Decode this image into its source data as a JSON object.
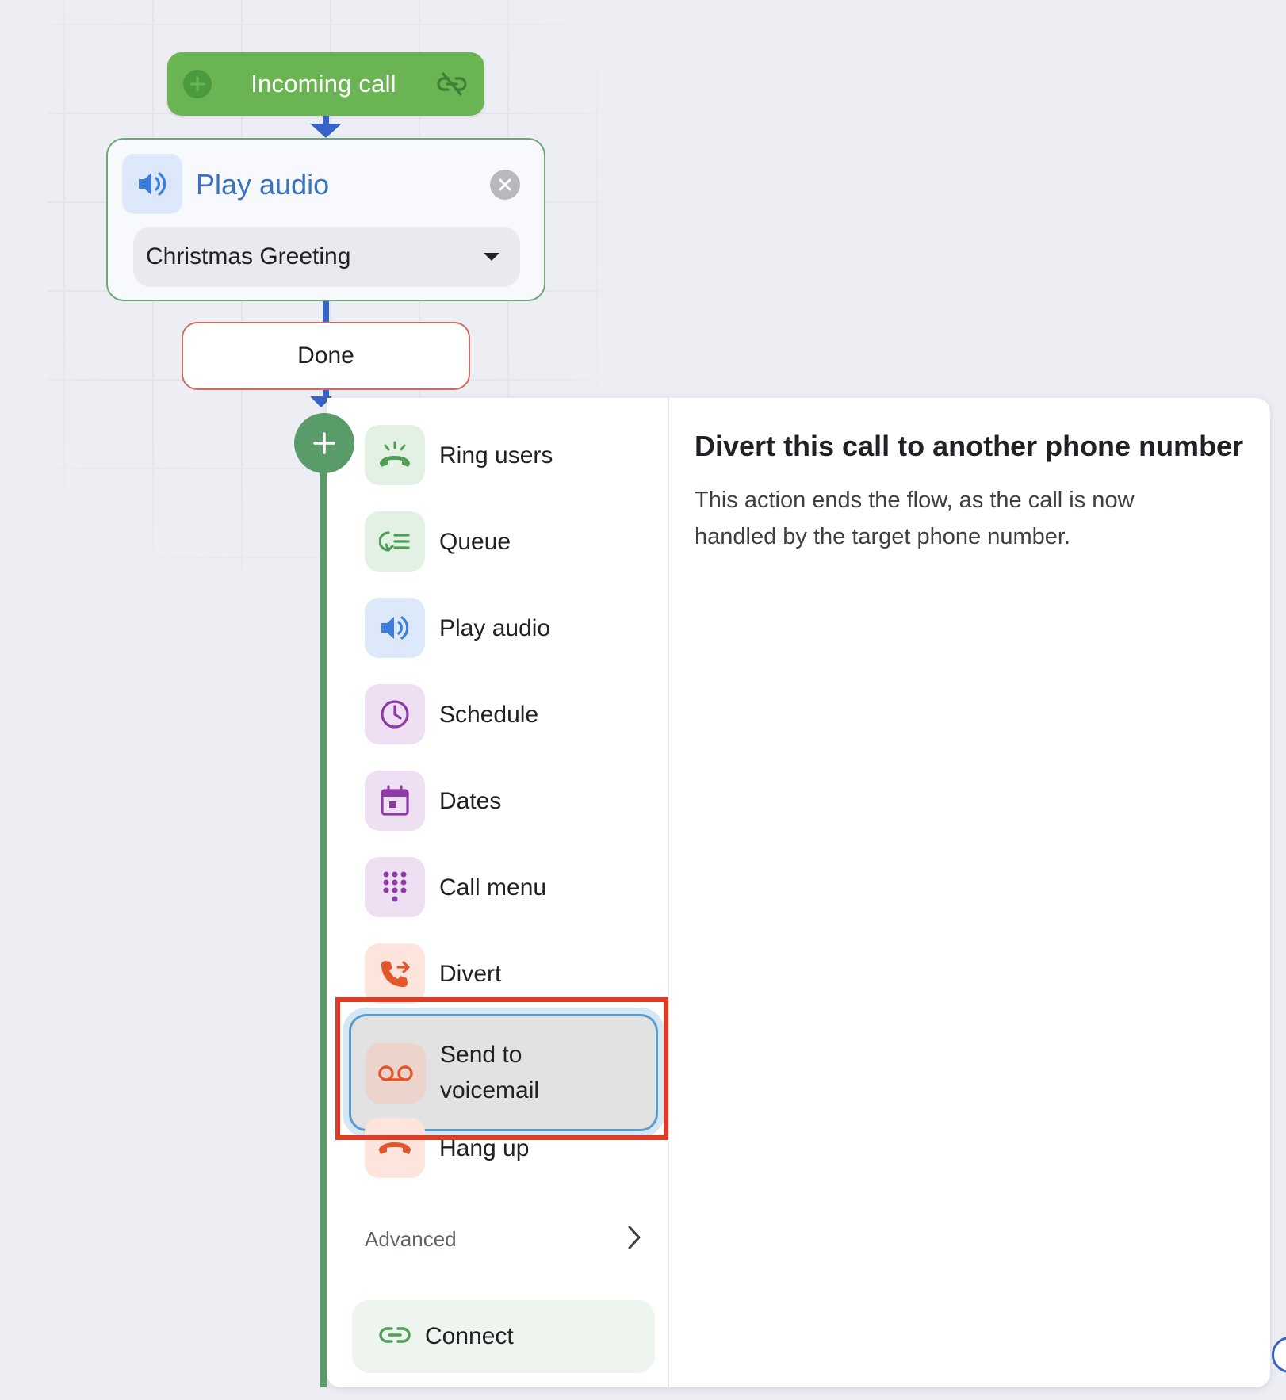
{
  "flow": {
    "incoming": {
      "title": "Incoming call"
    },
    "play_card": {
      "title": "Play audio",
      "selected_audio": "Christmas Greeting"
    },
    "done_label": "Done"
  },
  "menu": {
    "items": [
      {
        "label": "Ring users",
        "icon": "ring-users-icon"
      },
      {
        "label": "Queue",
        "icon": "queue-icon"
      },
      {
        "label": "Play audio",
        "icon": "speaker-icon"
      },
      {
        "label": "Schedule",
        "icon": "clock-icon"
      },
      {
        "label": "Dates",
        "icon": "calendar-icon"
      },
      {
        "label": "Call menu",
        "icon": "dialpad-icon"
      },
      {
        "label": "Divert",
        "icon": "divert-icon"
      },
      {
        "label": "Send to voicemail",
        "icon": "voicemail-icon"
      },
      {
        "label": "Hang up",
        "icon": "hang-up-icon"
      }
    ],
    "advanced_label": "Advanced",
    "connect_label": "Connect"
  },
  "details": {
    "title": "Divert this call to another phone number",
    "description": "This action ends the flow, as the call is now handled by the target phone number."
  },
  "colors": {
    "green": "#6ab454",
    "blue": "#3b71c1",
    "purple": "#8e3aa6",
    "orange": "#e2562b",
    "highlight": "#e03b24"
  }
}
